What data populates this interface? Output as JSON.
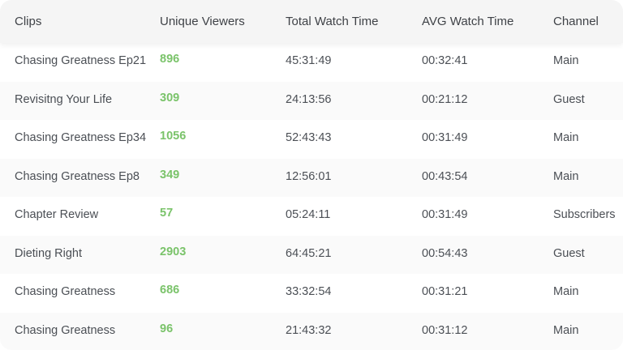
{
  "table": {
    "columns": [
      "Clips",
      "Unique Viewers",
      "Total Watch Time",
      "AVG Watch Time",
      "Channel"
    ],
    "rows": [
      {
        "clip": "Chasing Greatness Ep21",
        "viewers": "896",
        "total": "45:31:49",
        "avg": "00:32:41",
        "channel": "Main"
      },
      {
        "clip": "Revisitng Your Life",
        "viewers": "309",
        "total": "24:13:56",
        "avg": "00:21:12",
        "channel": "Guest"
      },
      {
        "clip": "Chasing Greatness Ep34",
        "viewers": "1056",
        "total": "52:43:43",
        "avg": "00:31:49",
        "channel": "Main"
      },
      {
        "clip": "Chasing Greatness Ep8",
        "viewers": "349",
        "total": "12:56:01",
        "avg": "00:43:54",
        "channel": "Main"
      },
      {
        "clip": "Chapter Review",
        "viewers": "57",
        "total": "05:24:11",
        "avg": "00:31:49",
        "channel": "Subscribers"
      },
      {
        "clip": "Dieting Right",
        "viewers": "2903",
        "total": "64:45:21",
        "avg": "00:54:43",
        "channel": "Guest"
      },
      {
        "clip": "Chasing Greatness",
        "viewers": "686",
        "total": "33:32:54",
        "avg": "00:31:21",
        "channel": "Main"
      },
      {
        "clip": "Chasing Greatness",
        "viewers": "96",
        "total": "21:43:32",
        "avg": "00:31:12",
        "channel": "Main"
      }
    ]
  },
  "colors": {
    "header_bg": "#f5f5f5",
    "alt_row_bg": "#fafafa",
    "viewers_accent": "#7ac36a",
    "text": "#4b4f55"
  }
}
